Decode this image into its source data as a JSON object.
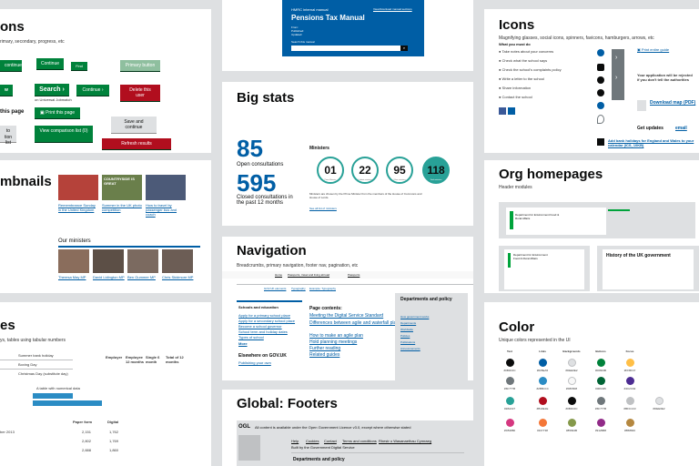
{
  "buttons_card": {
    "title": "ons",
    "subtitle": "rimary, secondary, progress, etc",
    "labels": [
      "continue",
      "Continue",
      "Find",
      "Primary button",
      "w",
      "Search",
      "Continue",
      "Delete this user",
      "on Universal Jobmatch",
      "this page",
      "Print this page",
      "Save and continue",
      "to",
      "tion list",
      "View comparison list (0)",
      "Refresh results"
    ]
  },
  "thumbnails_card": {
    "title": "mbnails",
    "news": [
      "Remembrance Sunday in the United Kingdom",
      "Summer in the UK photo competition",
      "How to travel by passenger bus and coach"
    ],
    "ministers_heading": "Our ministers",
    "ministers": [
      "Theresa May MP",
      "David Lidington MP",
      "Ben Gummer MP",
      "Chris Skidmore MP"
    ],
    "overlay_text": "COUNTRYSIDE IS GREAT"
  },
  "tables_card": {
    "title": "es",
    "subtitle": "ys, tables using tabular numbers",
    "rows": [
      "Summer bank holiday",
      "Boxing Day",
      "Christmas Day (substitute day)"
    ],
    "chart_caption": "A table with numerical data",
    "bottom_headers": [
      "Paper form",
      "Digital"
    ],
    "bottom_rows": [
      [
        "ber 2013",
        "2,151",
        "1,762"
      ],
      [
        "",
        "2,802",
        "1,769"
      ],
      [
        "",
        "2,888",
        "1,860"
      ]
    ],
    "mid_headers": [
      "Employer",
      "Employee 12 months",
      "Single 6 month",
      "Total of 12 months"
    ]
  },
  "manual_card": {
    "kicker": "HMRC internal manual",
    "title": "Pensions Tax Manual",
    "top_right": "View/download manual sections",
    "from": "From:",
    "published": "Published:",
    "updated": "Updated:",
    "search_label": "Search this manual"
  },
  "bigstats_card": {
    "title": "Big stats",
    "stat1_num": "85",
    "stat1_label": "Open consultations",
    "stat2_num": "595",
    "stat2_label": "Closed consultations in the past 12 months",
    "ministers_label": "Ministers",
    "circles": [
      {
        "num": "01",
        "label": "Prime Minister"
      },
      {
        "num": "22",
        "label": "Cabinet ministers"
      },
      {
        "num": "95",
        "label": "Other ministers"
      },
      {
        "num": "118",
        "label": "Total ministers"
      }
    ],
    "note": "Ministers are chosen by the Prime Minister from the members of the House of Commons and House of Lords.",
    "note_link": "See all list of ministers"
  },
  "navigation_card": {
    "title": "Navigation",
    "subtitle": "Breadcrumbs, primary navigation, footer nav, pagination, etc",
    "breadcrumbs": [
      "Home",
      "Passports, travel and living abroad",
      "Passports"
    ],
    "tabs": [
      "GOV.UK elements",
      "Typography",
      "Example: Typography"
    ],
    "schools_heading": "Schools and education",
    "schools_links": [
      "Apply for a primary school place",
      "Apply for a secondary school place",
      "Become a school governor",
      "School term and holiday dates",
      "Types of school",
      "More"
    ],
    "elsewhere_heading": "Elsewhere on GOV.UK",
    "elsewhere_link": "Publishing your own",
    "contents_heading": "Page contents:",
    "contents": [
      "Meeting the Digital Service Standard",
      "Differences between agile and waterfall planning",
      "How to make an agile plan",
      "Hold planning meetings",
      "Further reading",
      "Related guides"
    ],
    "depts_heading": "Departments and policy",
    "depts_links": [
      "How government works",
      "Departments",
      "Worldwide",
      "Policies",
      "Publications",
      "Announcements"
    ]
  },
  "footers_card": {
    "title": "Global: Footers",
    "ogl_badge": "OGL",
    "ogl_text": "All content is available under the Open Government Licence v3.0, except where otherwise stated",
    "footer_links": [
      "Help",
      "Cookies",
      "Contact",
      "Terms and conditions",
      "Rhestr o Wasanaethau Cymraeg"
    ],
    "built_by": "Built by the Government Digital Service",
    "depts_heading": "Departments and policy"
  },
  "icons_card": {
    "title": "Icons",
    "subtitle": "Magnifying glasses, social icons, spinners, favicons, hamburgers, arrows, etc",
    "what_heading": "What you must do",
    "steps": [
      "Take notes about your concerns",
      "Check what the school says",
      "Check the school's complaints policy",
      "Write a letter to the school",
      "Share information",
      "Contact the school"
    ],
    "print_link": "Print entire guide",
    "warning": "Your application will be rejected if you don't tell the authorities",
    "download": "Download map (PDF)",
    "get_updates": "Get updates",
    "email": "email",
    "add_link": "Add bank holidays for England and Wales to your calendar (ICS, 10KB)"
  },
  "org_card": {
    "title": "Org homepages",
    "subtitle": "Header modules",
    "dept1": "Department for Environment Food & Rural Affairs",
    "dept2": "Department for Environment Food & Rural Affairs",
    "history_title": "History of the UK government"
  },
  "color_card": {
    "title": "Color",
    "subtitle": "Unique colors represented in the UI",
    "headers": [
      "Text",
      "Links",
      "Backgrounds",
      "Buttons",
      "Focus"
    ],
    "swatches": [
      {
        "hex": "#0b0c0c",
        "code": "#0B0C0C"
      },
      {
        "hex": "#005ea5",
        "code": "#005EA5"
      },
      {
        "hex": "#dee0e2",
        "code": "#DEE0E2"
      },
      {
        "hex": "#00823b",
        "code": "#00823B"
      },
      {
        "hex": "#ffbf47",
        "code": "#FFBF47"
      },
      {
        "hex": "#6f777b",
        "code": "#6F777B"
      },
      {
        "hex": "#2b8cc4",
        "code": "#2B8CC4"
      },
      {
        "hex": "#f8f8f8",
        "code": "#F8F8F8"
      },
      {
        "hex": "#006435",
        "code": "#006435"
      },
      {
        "hex": "#4c2c92",
        "code": "#4C2C92"
      },
      {
        "hex": "#28a197",
        "code": "#28A197"
      },
      {
        "hex": "#b10e1e",
        "code": "#B10E1E"
      },
      {
        "hex": "#0b0c0c",
        "code": "#0B0C0C"
      },
      {
        "hex": "#6f777b",
        "code": "#6F777B"
      },
      {
        "hex": "#bfc1c3",
        "code": "#BFC1C3"
      },
      {
        "hex": "#dee0e2",
        "code": "#DEE0E2"
      },
      {
        "hex": "#d53880",
        "code": "#D53880"
      },
      {
        "hex": "#f47738",
        "code": "#F47738"
      },
      {
        "hex": "#85994b",
        "code": "#85994B"
      },
      {
        "hex": "#912b88",
        "code": "#912B88"
      },
      {
        "hex": "#b58840",
        "code": "#B58840"
      }
    ]
  }
}
